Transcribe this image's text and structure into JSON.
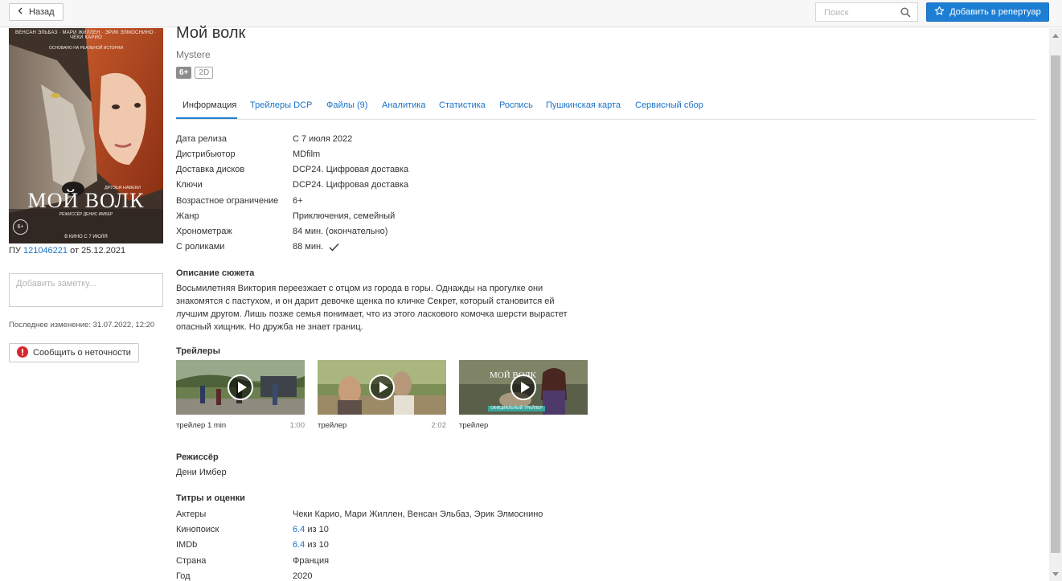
{
  "topbar": {
    "back_label": "Назад",
    "search_placeholder": "Поиск",
    "add_label": "Добавить в репертуар",
    "accent_color": "#1d7fd4"
  },
  "left": {
    "poster_credit_top": "ВЕНСАН ЭЛЬБАЗ · МАРИ ЖИЛЛЕН · ЭРИК ЭЛМОСНИНО · ЧЕКИ КАРИО",
    "poster_tagline": "ОСНОВАНО НА РЕАЛЬНОЙ ИСТОРИИ",
    "poster_friends": "ДРУЗЬЯ НАВЕКИ",
    "poster_title": "МОЙ ВОЛК",
    "poster_director": "РЕЖИССЁР ДЕНИС ИМБЕР",
    "poster_release": "В КИНО С 7 ИЮЛЯ",
    "poster_age": "6+",
    "pu_prefix": "ПУ",
    "pu_number": "121046221",
    "pu_suffix": "от 25.12.2021",
    "note_placeholder": "Добавить заметку...",
    "last_change": "Последнее изменение: 31.07.2022, 12:20",
    "report_label": "Сообщить о неточности"
  },
  "film": {
    "title": "Мой волк",
    "original_title": "Mystere",
    "age_badge": "6+",
    "format_badge": "2D"
  },
  "tabs": [
    {
      "label": "Информация"
    },
    {
      "label": "Трейлеры DCP"
    },
    {
      "label": "Файлы (9)"
    },
    {
      "label": "Аналитика"
    },
    {
      "label": "Статистика"
    },
    {
      "label": "Роспись"
    },
    {
      "label": "Пушкинская карта"
    },
    {
      "label": "Сервисный сбор"
    }
  ],
  "info": [
    {
      "label": "Дата релиза",
      "value": "С 7 июля 2022"
    },
    {
      "label": "Дистрибьютор",
      "value": "MDfilm"
    },
    {
      "label": "Доставка дисков",
      "value": "DCP24. Цифровая доставка"
    },
    {
      "label": "Ключи",
      "value": "DCP24. Цифровая доставка"
    },
    {
      "label": "Возрастное ограничение",
      "value": "6+"
    },
    {
      "label": "Жанр",
      "value": "Приключения, семейный"
    },
    {
      "label": "Хронометраж",
      "value": "84 мин. (окончательно)"
    },
    {
      "label": "С роликами",
      "value": "88 мин."
    }
  ],
  "plot": {
    "heading": "Описание сюжета",
    "text": "Восьмилетняя Виктория переезжает с отцом из города в горы. Однажды на прогулке они знакомятся с пастухом, и он дарит девочке щенка по кличке Секрет, который становится ей лучшим другом. Лишь позже семья понимает, что из этого ласкового комочка шерсти вырастет опасный хищник. Но дружба не знает границ."
  },
  "trailers": {
    "heading": "Трейлеры",
    "items": [
      {
        "label": "трейлер 1 min",
        "duration": "1:00"
      },
      {
        "label": "трейлер",
        "duration": "2:02"
      },
      {
        "label": "трейлер",
        "duration": "",
        "thumb_title": "МОЙ ВОЛК",
        "thumb_badge": "ОФИЦИАЛЬНЫЙ ТРЕЙЛЕР"
      }
    ]
  },
  "director": {
    "heading": "Режиссёр",
    "name": "Дени Имбер"
  },
  "credits": {
    "heading": "Титры и оценки",
    "rows": [
      {
        "label": "Актеры",
        "value": "Чеки Карио, Мари Жиллен, Венсан Эльбаз, Эрик Элмоснино"
      },
      {
        "label": "Кинопоиск",
        "score": "6.4",
        "suffix": "из 10"
      },
      {
        "label": "IMDb",
        "score": "6.4",
        "suffix": "из 10"
      },
      {
        "label": "Страна",
        "value": "Франция"
      },
      {
        "label": "Год",
        "value": "2020"
      }
    ]
  }
}
